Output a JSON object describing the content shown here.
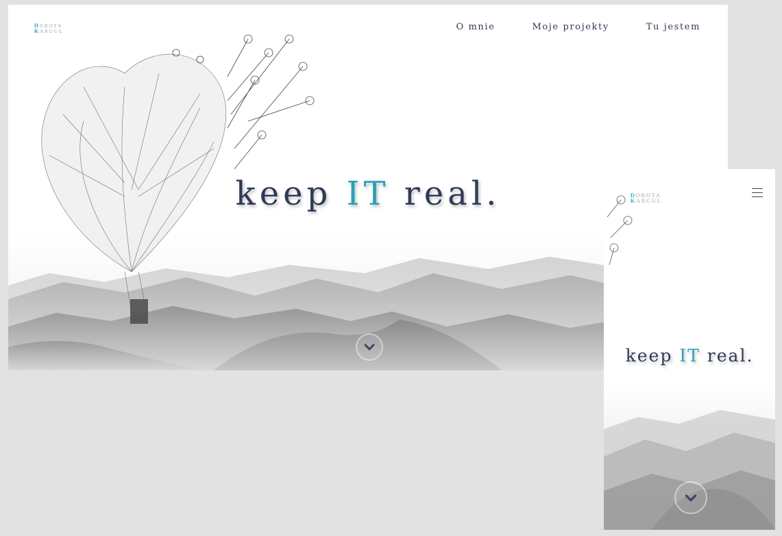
{
  "desktop": {
    "logo": {
      "line1_cap": "D",
      "line1_rest": "OROTA",
      "line2_cap": "K",
      "line2_rest": "ARGUL"
    },
    "nav": [
      {
        "label": "O mnie"
      },
      {
        "label": "Moje projekty"
      },
      {
        "label": "Tu jestem"
      }
    ],
    "hero": {
      "pre": "keep ",
      "accent": "IT",
      "post": " real."
    },
    "scroll_icon": "chevron-down-icon"
  },
  "mobile": {
    "logo": {
      "line1_cap": "D",
      "line1_rest": "OROTA",
      "line2_cap": "K",
      "line2_rest": "ARGUL"
    },
    "menu_icon": "hamburger-icon",
    "hero": {
      "pre": "keep ",
      "accent": "IT",
      "post": " real."
    },
    "scroll_icon": "chevron-down-icon"
  },
  "colors": {
    "accent": "#29a1b5",
    "text": "#2f3a58",
    "background": "#e2e2e2"
  }
}
